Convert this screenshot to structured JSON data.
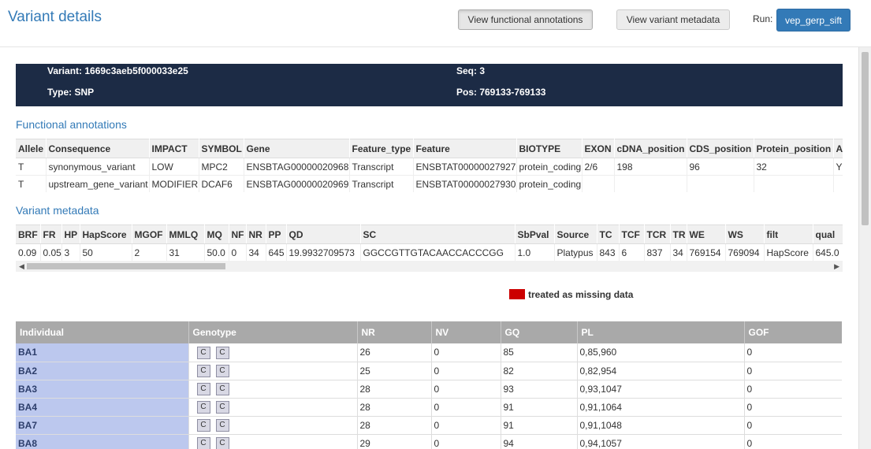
{
  "header": {
    "title": "Variant details",
    "btn_functional": "View functional annotations",
    "btn_metadata": "View variant metadata",
    "run_label": "Run:",
    "run_value": "vep_gerp_sift"
  },
  "variant": {
    "variant": "Variant: 1669c3aeb5f000033e25",
    "type": "Type: SNP",
    "seq": "Seq: 3",
    "pos": "Pos: 769133-769133"
  },
  "functional": {
    "title": "Functional annotations",
    "headers": [
      "Allele",
      "Consequence",
      "IMPACT",
      "SYMBOL",
      "Gene",
      "Feature_type",
      "Feature",
      "BIOTYPE",
      "EXON",
      "cDNA_position",
      "CDS_position",
      "Protein_position",
      "A"
    ],
    "rows": [
      [
        "T",
        "synonymous_variant",
        "LOW",
        "MPC2",
        "ENSBTAG00000020968",
        "Transcript",
        "ENSBTAT00000027927",
        "protein_coding",
        "2/6",
        "198",
        "96",
        "32",
        "Y"
      ],
      [
        "T",
        "upstream_gene_variant",
        "MODIFIER",
        "DCAF6",
        "ENSBTAG00000020969",
        "Transcript",
        "ENSBTAT00000027930",
        "protein_coding",
        "",
        "",
        "",
        "",
        ""
      ]
    ]
  },
  "metadata": {
    "title": "Variant metadata",
    "headers": [
      "BRF",
      "FR",
      "HP",
      "HapScore",
      "MGOF",
      "MMLQ",
      "MQ",
      "NF",
      "NR",
      "PP",
      "QD",
      "SC",
      "SbPval",
      "Source",
      "TC",
      "TCF",
      "TCR",
      "TR",
      "WE",
      "WS",
      "filt",
      "qual"
    ],
    "row": [
      "0.09",
      "0.05",
      "3",
      "50",
      "2",
      "31",
      "50.0",
      "0",
      "34",
      "645",
      "19.9932709573",
      "GGCCGTTGTACAACCACCCGG",
      "1.0",
      "Platypus",
      "843",
      "6",
      "837",
      "34",
      "769154",
      "769094",
      "HapScore",
      "645.0"
    ]
  },
  "legend": {
    "text": "treated as missing data",
    "color": "#cc0000"
  },
  "individuals": {
    "headers": [
      "Individual",
      "Genotype",
      "NR",
      "NV",
      "GQ",
      "PL",
      "GOF"
    ],
    "rows": [
      {
        "name": "BA1",
        "a1": "C",
        "a2": "C",
        "nr": "26",
        "nv": "0",
        "gq": "85",
        "pl": "0,85,960",
        "gof": "0"
      },
      {
        "name": "BA2",
        "a1": "C",
        "a2": "C",
        "nr": "25",
        "nv": "0",
        "gq": "82",
        "pl": "0,82,954",
        "gof": "0"
      },
      {
        "name": "BA3",
        "a1": "C",
        "a2": "C",
        "nr": "28",
        "nv": "0",
        "gq": "93",
        "pl": "0,93,1047",
        "gof": "0"
      },
      {
        "name": "BA4",
        "a1": "C",
        "a2": "C",
        "nr": "28",
        "nv": "0",
        "gq": "91",
        "pl": "0,91,1064",
        "gof": "0"
      },
      {
        "name": "BA7",
        "a1": "C",
        "a2": "C",
        "nr": "28",
        "nv": "0",
        "gq": "91",
        "pl": "0,91,1048",
        "gof": "0"
      },
      {
        "name": "BA8",
        "a1": "C",
        "a2": "C",
        "nr": "29",
        "nv": "0",
        "gq": "94",
        "pl": "0,94,1057",
        "gof": "0"
      }
    ]
  }
}
